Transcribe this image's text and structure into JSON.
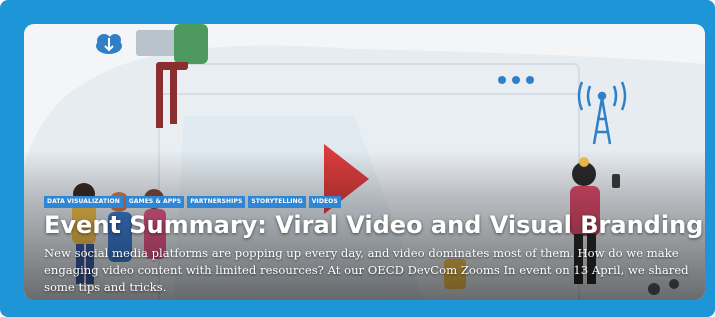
{
  "colors": {
    "frame": "#1e95d6",
    "tag_background": "#2f86d4",
    "play_triangle": "#d93c3c",
    "title_text": "#ffffff"
  },
  "icons": [
    "cloud-download-icon",
    "window-dots-icon",
    "play-icon",
    "broadcast-tower-icon"
  ],
  "card": {
    "tags": [
      "DATA VISUALIZATION",
      "GAMES & APPS",
      "PARTNERSHIPS",
      "STORYTELLING",
      "VIDEOS"
    ],
    "title": "Event Summary: Viral Video and Visual Branding",
    "description": "New social media platforms are popping up every day, and video dominates most of them. How do we make engaging video content with limited resources? At our OECD DevCom Zooms In event on 13 April, we shared some tips and tricks."
  }
}
